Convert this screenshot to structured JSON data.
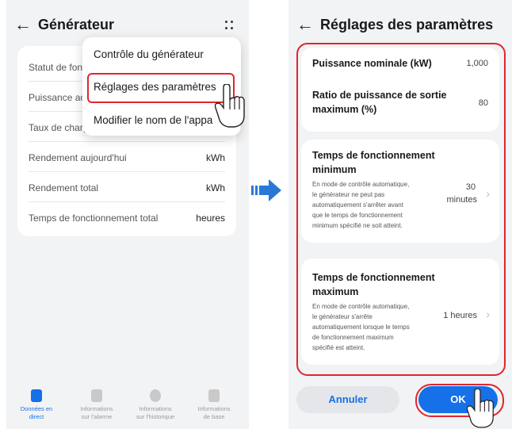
{
  "left": {
    "title": "Générateur",
    "back_glyph": "←",
    "rows": [
      {
        "label": "Statut de fon",
        "value": ""
      },
      {
        "label": "Puissance ac",
        "value": ""
      },
      {
        "label": "Taux de charg",
        "value": ""
      },
      {
        "label": "Rendement aujourd'hui",
        "value": "kWh"
      },
      {
        "label": "Rendement total",
        "value": "kWh"
      },
      {
        "label": "Temps de fonctionnement total",
        "value": "heures"
      }
    ],
    "menu": [
      {
        "label": "Contrôle du générateur"
      },
      {
        "label": "Réglages des paramètres"
      },
      {
        "label": "Modifier le nom de l'appa"
      }
    ],
    "tabs": [
      {
        "line1": "Données en",
        "line2": "direct",
        "icon": "live-data-icon"
      },
      {
        "line1": "Informations",
        "line2": "sur l'alarme",
        "icon": "alarm-icon"
      },
      {
        "line1": "Informations",
        "line2": "sur l'historique",
        "icon": "history-icon"
      },
      {
        "line1": "Informations",
        "line2": "de base",
        "icon": "basic-info-icon"
      }
    ]
  },
  "right": {
    "title": "Réglages des paramètres",
    "back_glyph": "←",
    "rated_power": {
      "label": "Puissance nominale (kW)",
      "value": "1,000"
    },
    "max_output": {
      "label_1": "Ratio de puissance de sortie",
      "label_2": "maximum (%)",
      "value": "80"
    },
    "min_runtime": {
      "label_1": "Temps de fonctionnement",
      "label_2": "minimum",
      "desc": [
        "En mode de contrôle automatique,",
        "le générateur ne peut pas",
        "automatiquement s'arrêter avant",
        "que le temps de fonctionnement",
        "minimum spécifié ne soit atteint."
      ],
      "value_1": "30",
      "value_2": "minutes"
    },
    "max_runtime": {
      "label_1": "Temps de fonctionnement",
      "label_2": "maximum",
      "desc": [
        "En mode de contrôle automatique,",
        "le générateur s'arrête",
        "automatiquement lorsque le temps",
        "de fonctionnement maximum",
        "spécifié est atteint."
      ],
      "value": "1 heures"
    },
    "cancel_label": "Annuler",
    "ok_label": "OK"
  },
  "colors": {
    "accent": "#1670e8",
    "highlight": "#e0262f",
    "arrow": "#2a78d6"
  },
  "chevron_glyph": "›"
}
